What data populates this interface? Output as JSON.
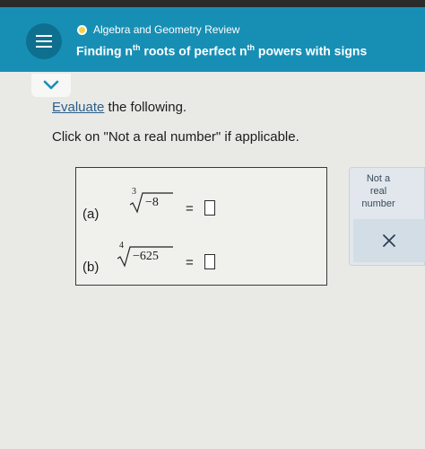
{
  "header": {
    "menu_icon": "hamburger-icon",
    "topic_dot_color": "#f2d24a",
    "topic": "Algebra and Geometry Review",
    "title_part1": "Finding n",
    "title_sup1": "th",
    "title_part2": " roots of perfect n",
    "title_sup2": "th",
    "title_part3": " powers with signs",
    "accent_color": "#178fb5"
  },
  "collapse_icon": "chevron-down-icon",
  "prompt": {
    "link": "Evaluate",
    "rest": " the following."
  },
  "instruction": "Click on \"Not a real number\" if applicable.",
  "problems": [
    {
      "label": "(a)",
      "index": "3",
      "radicand": "−8",
      "equals": "="
    },
    {
      "label": "(b)",
      "index": "4",
      "radicand": "−625",
      "equals": "="
    }
  ],
  "side_panel": {
    "not_real_line1": "Not a",
    "not_real_line2": "real",
    "not_real_line3": "number",
    "clear_symbol": "✕"
  }
}
